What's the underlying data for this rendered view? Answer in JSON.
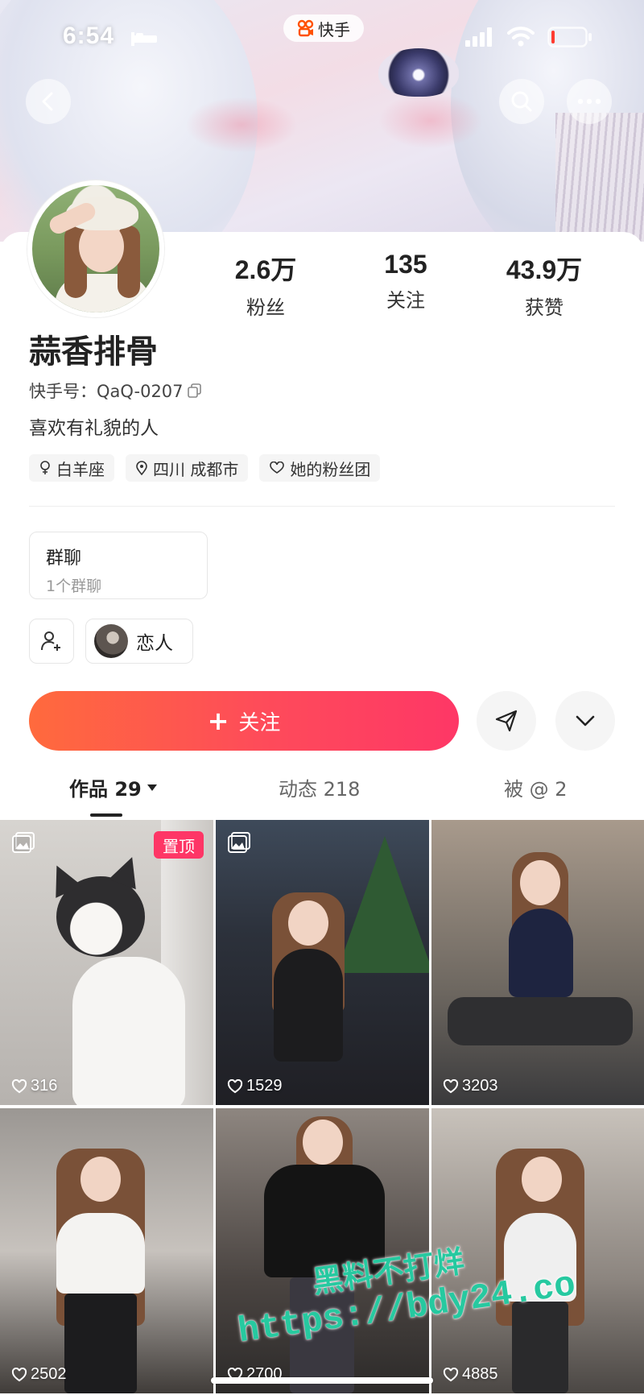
{
  "status_bar": {
    "time": "6:54",
    "app_name": "快手"
  },
  "header": {
    "back_icon": "chevron-left-icon",
    "search_icon": "search-icon",
    "more_icon": "more-dots-icon"
  },
  "profile": {
    "stats": [
      {
        "value": "2.6万",
        "label": "粉丝"
      },
      {
        "value": "135",
        "label": "关注"
      },
      {
        "value": "43.9万",
        "label": "获赞"
      }
    ],
    "name": "蒜香排骨",
    "kuaishou_id": "快手号：QaQ-0207",
    "bio": "喜欢有礼貌的人",
    "tags": [
      "白羊座",
      "四川 成都市",
      "她的粉丝团"
    ],
    "group_chat": {
      "title": "群聊",
      "subtitle": "1个群聊"
    },
    "relation_label": "恋人"
  },
  "actions": {
    "follow_label": "关注",
    "follow_plus": "+"
  },
  "tabs": [
    {
      "label": "作品 29",
      "active": true
    },
    {
      "label": "动态 218",
      "active": false
    },
    {
      "label": "被 @ 2",
      "active": false
    }
  ],
  "grid": [
    {
      "likes": "316",
      "pinned_label": "置顶",
      "multi_image": true
    },
    {
      "likes": "1529",
      "multi_image": true
    },
    {
      "likes": "3203"
    },
    {
      "likes": "2502"
    },
    {
      "likes": "2700"
    },
    {
      "likes": "4885"
    }
  ],
  "watermark": {
    "line1": "黑料不打烊",
    "line2": "https://bdy24.co"
  },
  "colors": {
    "accent": "#fe3666",
    "follow_gradient_start": "#ff6a3d",
    "follow_gradient_end": "#fe3766"
  }
}
